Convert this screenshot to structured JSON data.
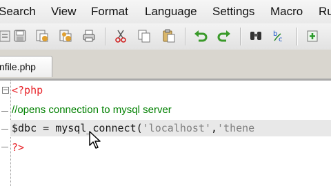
{
  "menu": {
    "items": [
      {
        "label": "Search"
      },
      {
        "label": "View"
      },
      {
        "label": "Format"
      },
      {
        "label": "Language"
      },
      {
        "label": "Settings"
      },
      {
        "label": "Macro"
      },
      {
        "label": "Ru"
      }
    ]
  },
  "toolbar": {
    "icons": [
      "open-icon",
      "save-icon",
      "save-all-icon",
      "close-icon",
      "close-all-icon",
      "print-icon",
      "cut-icon",
      "copy-icon",
      "paste-icon",
      "undo-icon",
      "redo-icon",
      "find-icon",
      "replace-icon",
      "zoom-in-icon"
    ]
  },
  "tabs": [
    {
      "label": "nfile.php"
    }
  ],
  "editor": {
    "lines": [
      {
        "tokens": [
          {
            "t": "<?php",
            "c": "tag"
          }
        ]
      },
      {
        "tokens": [
          {
            "t": "//opens connection to mysql server",
            "c": "comment"
          }
        ]
      },
      {
        "tokens": [
          {
            "t": "$dbc",
            "c": "var"
          },
          {
            "t": " = ",
            "c": "op"
          },
          {
            "t": "mysql_connect",
            "c": "fn"
          },
          {
            "t": "(",
            "c": "op"
          },
          {
            "t": "'localhost'",
            "c": "str"
          },
          {
            "t": ",",
            "c": "op"
          },
          {
            "t": "'thene",
            "c": "str"
          }
        ]
      },
      {
        "tokens": [
          {
            "t": "?>",
            "c": "tag"
          }
        ]
      }
    ],
    "current_line": 3
  }
}
